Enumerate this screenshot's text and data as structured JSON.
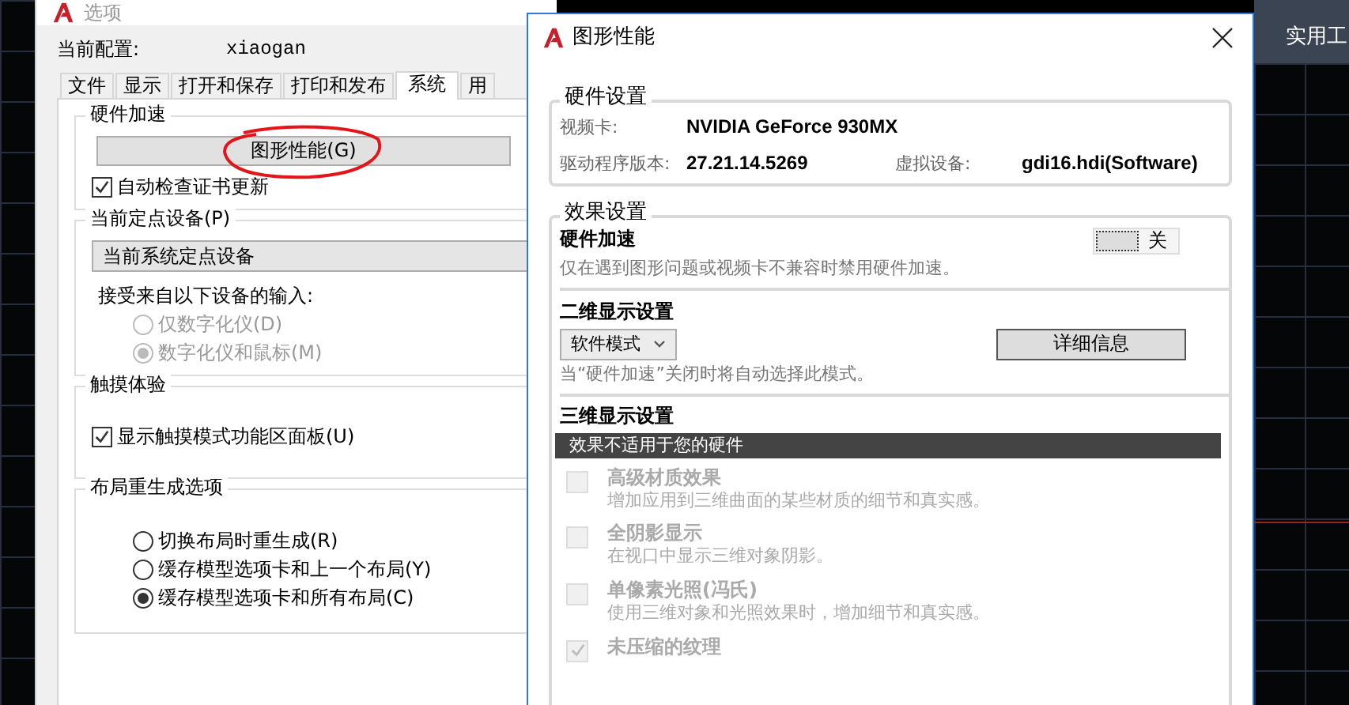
{
  "app": {
    "ribbon_tab": "实用工"
  },
  "options_dialog": {
    "title": "选项",
    "profile_label": "当前配置:",
    "profile_value": "xiaogan",
    "tabs": [
      {
        "label": "文件",
        "selected": false
      },
      {
        "label": "显示",
        "selected": false
      },
      {
        "label": "打开和保存",
        "selected": false
      },
      {
        "label": "打印和发布",
        "selected": false
      },
      {
        "label": "系统",
        "selected": true
      },
      {
        "label": "用",
        "selected": false
      }
    ],
    "hardware": {
      "title": "硬件加速",
      "button": "图形性能(G)",
      "checkbox": {
        "label": "自动检查证书更新",
        "checked": true
      }
    },
    "pointing": {
      "title": "当前定点设备(P)",
      "value": "当前系统定点设备",
      "input_label": "接受来自以下设备的输入:",
      "options": [
        {
          "label": "仅数字化仪(D)",
          "selected": false,
          "disabled": true
        },
        {
          "label": "数字化仪和鼠标(M)",
          "selected": true,
          "disabled": true
        }
      ]
    },
    "touch": {
      "title": "触摸体验",
      "checkbox": {
        "label": "显示触摸模式功能区面板(U)",
        "checked": true
      }
    },
    "layout_regen": {
      "title": "布局重生成选项",
      "options": [
        {
          "label": "切换布局时重生成(R)",
          "selected": false,
          "disabled": false
        },
        {
          "label": "缓存模型选项卡和上一个布局(Y)",
          "selected": false,
          "disabled": false
        },
        {
          "label": "缓存模型选项卡和所有布局(C)",
          "selected": true,
          "disabled": false
        }
      ]
    }
  },
  "graphics_dialog": {
    "title": "图形性能",
    "hardware_settings": {
      "title": "硬件设置",
      "rows": [
        {
          "label": "视频卡:",
          "value": "NVIDIA GeForce 930MX"
        },
        {
          "label": "驱动程序版本:",
          "value": "27.21.14.5269",
          "label_2": "虚拟设备:",
          "value_2": "gdi16.hdi(Software)"
        }
      ]
    },
    "effects": {
      "title": "效果设置",
      "acceleration": {
        "title": "硬件加速",
        "toggle_label": "关",
        "on": false,
        "description": "仅在遇到图形问题或视频卡不兼容时禁用硬件加速。"
      },
      "display_2d": {
        "title": "二维显示设置",
        "mode": "软件模式",
        "details_button": "详细信息",
        "note": "当“硬件加速”关闭时将自动选择此模式。"
      },
      "display_3d": {
        "title": "三维显示设置",
        "banner": "效果不适用于您的硬件",
        "items": [
          {
            "title": "高级材质效果",
            "description": "增加应用到三维曲面的某些材质的细节和真实感。",
            "checked": false,
            "disabled": true
          },
          {
            "title": "全阴影显示",
            "description": "在视口中显示三维对象阴影。",
            "checked": false,
            "disabled": true
          },
          {
            "title": "单像素光照(冯氏)",
            "description": "使用三维对象和光照效果时，增加细节和真实感。",
            "checked": false,
            "disabled": true
          },
          {
            "title": "未压缩的纹理",
            "checked": true,
            "disabled": true
          }
        ]
      }
    }
  }
}
